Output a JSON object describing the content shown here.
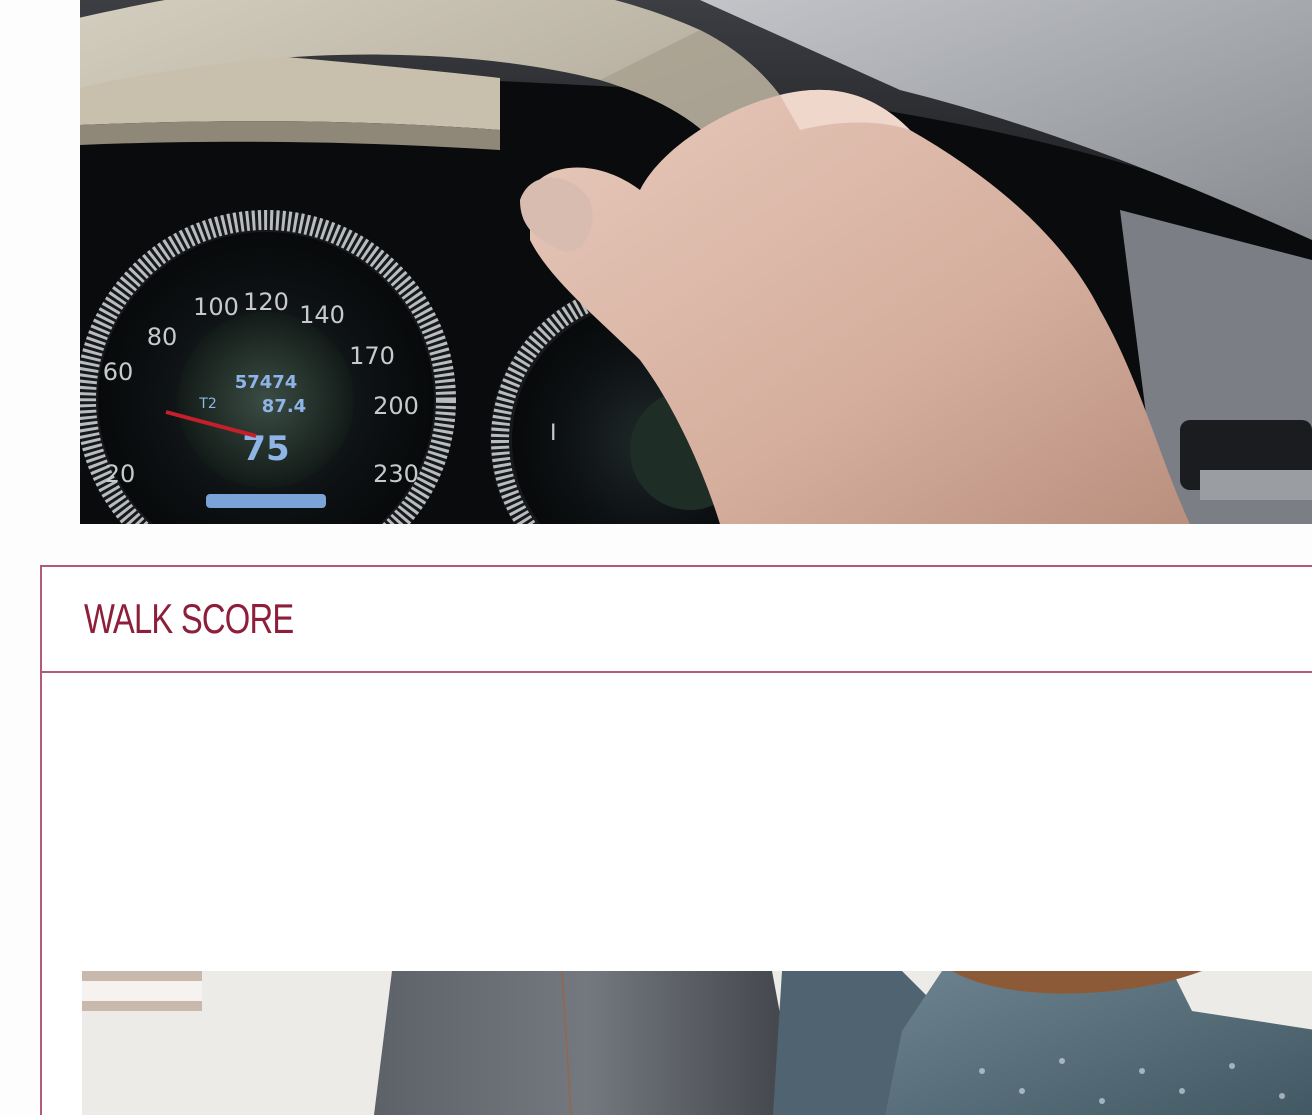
{
  "walk_score": {
    "title": "WALK SCORE"
  },
  "images": {
    "dashboard_photo": "car-dashboard-steering-wheel-photo",
    "walk_photo": "people-walking-photo"
  },
  "colors": {
    "accent": "#8d1f3a",
    "border": "#b35a7a"
  }
}
